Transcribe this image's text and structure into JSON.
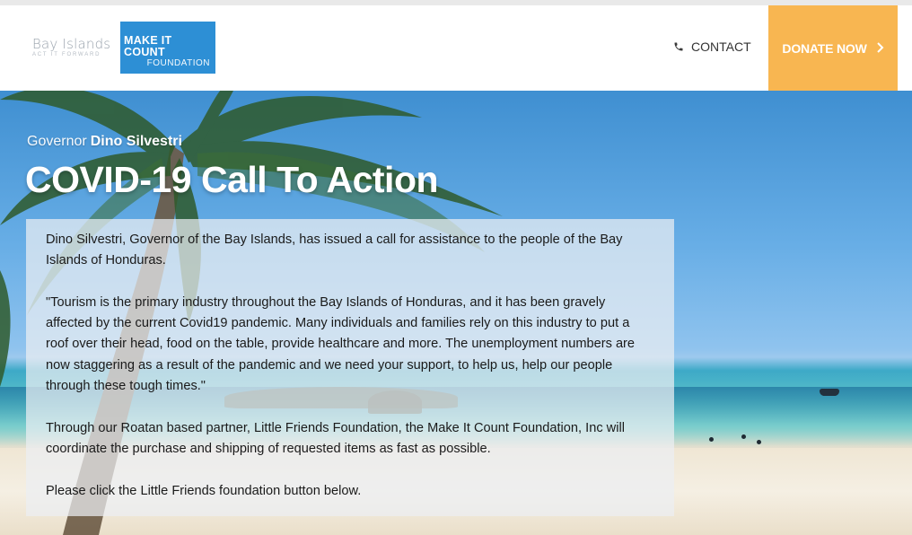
{
  "header": {
    "logo_primary": {
      "text": "Bay Islands",
      "tagline": "ACT IT FORWARD"
    },
    "logo_secondary": {
      "line1": "MAKE IT COUNT",
      "line2": "FOUNDATION"
    },
    "contact_label": "CONTACT",
    "donate_label": "DONATE NOW",
    "colors": {
      "brand_blue": "#2d8fd5",
      "donate_orange": "#f8b651"
    },
    "icons": {
      "contact": "phone-icon",
      "donate": "chevron-right-icon"
    }
  },
  "hero": {
    "governor_prefix": "Governor",
    "governor_name": "Dino Silvestri",
    "title": "COVID-19 Call To Action",
    "paragraphs": [
      "Dino Silvestri, Governor of the Bay Islands,  has issued a call for assistance to the people of the Bay Islands of Honduras.",
      "\"Tourism is the primary industry throughout the Bay Islands of Honduras, and it has been gravely affected by the current Covid19 pandemic. Many individuals and families rely on this industry to put a roof over their head, food on the table, provide healthcare and more. The unemployment numbers are now staggering as a result of the pandemic and we need your support, to help us, help our people through these tough times.\"",
      "Through our Roatan based partner, Little Friends Foundation, the Make It Count Foundation, Inc will coordinate the purchase and shipping of requested items as fast as possible.",
      "Please click the Little Friends foundation button below."
    ]
  }
}
